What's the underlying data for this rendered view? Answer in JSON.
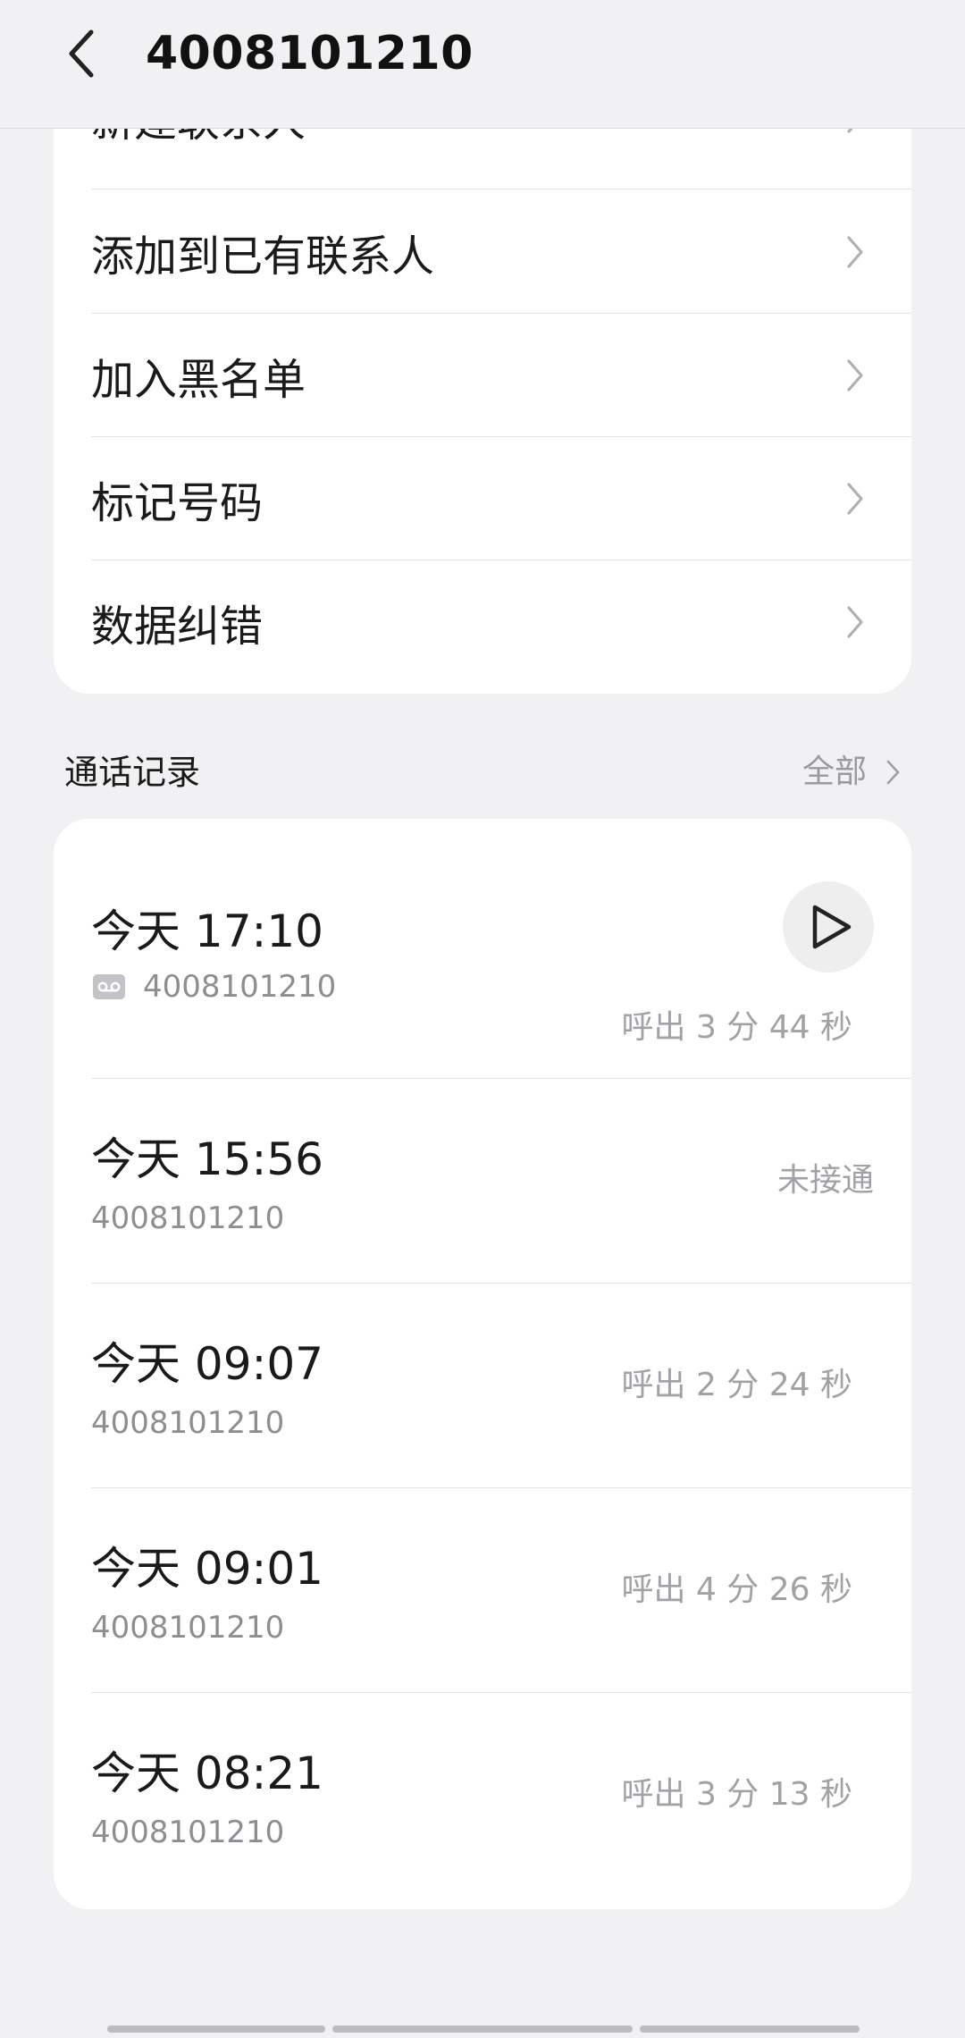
{
  "header": {
    "title": "4008101210"
  },
  "actions": [
    {
      "label": "新建联系人"
    },
    {
      "label": "添加到已有联系人"
    },
    {
      "label": "加入黑名单"
    },
    {
      "label": "标记号码"
    },
    {
      "label": "数据纠错"
    }
  ],
  "call_log": {
    "title": "通话记录",
    "all_label": "全部",
    "entries": [
      {
        "time": "今天 17:10",
        "number": "4008101210",
        "status": "呼出 3 分 44 秒",
        "has_recording": true
      },
      {
        "time": "今天 15:56",
        "number": "4008101210",
        "status": "未接通",
        "has_recording": false
      },
      {
        "time": "今天 09:07",
        "number": "4008101210",
        "status": "呼出 2 分 24 秒",
        "has_recording": false
      },
      {
        "time": "今天 09:01",
        "number": "4008101210",
        "status": "呼出 4 分 26 秒",
        "has_recording": false
      },
      {
        "time": "今天 08:21",
        "number": "4008101210",
        "status": "呼出 3 分 13 秒",
        "has_recording": false
      }
    ]
  },
  "icons": {
    "back": "chevron-left-icon",
    "row_arrow": "chevron-right-icon",
    "play": "play-icon",
    "recording": "voicemail-icon"
  },
  "colors": {
    "background": "#f1f1f3",
    "card": "#ffffff",
    "primary_text": "#1a1a1a",
    "secondary_text": "#8e8e92",
    "chevron": "#b0b0b4"
  }
}
